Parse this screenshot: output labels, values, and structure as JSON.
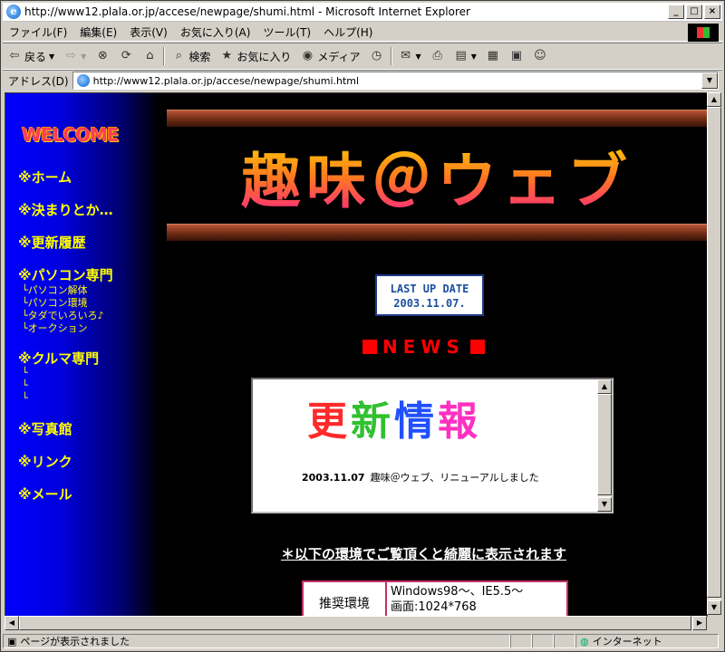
{
  "window": {
    "title": "http://www12.plala.or.jp/accese/newpage/shumi.html - Microsoft Internet Explorer"
  },
  "menu": [
    "ファイル(F)",
    "編集(E)",
    "表示(V)",
    "お気に入り(A)",
    "ツール(T)",
    "ヘルプ(H)"
  ],
  "toolbar": {
    "back": "戻る",
    "search": "検索",
    "favorites": "お気に入り",
    "media": "メディア"
  },
  "address": {
    "label": "アドレス(D)",
    "url": "http://www12.plala.or.jp/accese/newpage/shumi.html"
  },
  "status": {
    "text": "ページが表示されました",
    "zone": "インターネット"
  },
  "page": {
    "welcome": "WELCOME",
    "nav": {
      "home": "※ホーム",
      "rules": "※決まりとか…",
      "history": "※更新履歴",
      "pc": "※パソコン専門",
      "pc_sub": [
        "└パソコン解体",
        "└パソコン環境",
        "└タダでいろいろ♪",
        "└オークション"
      ],
      "car": "※クルマ専門",
      "car_sub": [
        "└",
        "└",
        "└"
      ],
      "photo": "※写真館",
      "link": "※リンク",
      "mail": "※メール"
    },
    "title": "趣味＠ウェブ",
    "last_up": {
      "label": "LAST UP DATE",
      "date": "2003.11.07."
    },
    "news_heading": "NEWS",
    "news_box": {
      "title_chars": [
        "更",
        "新",
        "情",
        "報"
      ],
      "title_colors": [
        "#ff2a2a",
        "#30c030",
        "#2050ff",
        "#ff30c0"
      ],
      "entry_date": "2003.11.07",
      "entry_text": "趣味＠ウェブ、リニューアルしました"
    },
    "notice": "＊以下の環境でご覧頂くと綺麗に表示されます",
    "env": {
      "label": "推奨環境",
      "line1": "Windows98～、IE5.5～",
      "line2": "画面:1024*768"
    }
  },
  "colors": {
    "nav_text": "#ffff00",
    "news_red": "#ff0000",
    "sidebar_blue": "#0000ff"
  }
}
